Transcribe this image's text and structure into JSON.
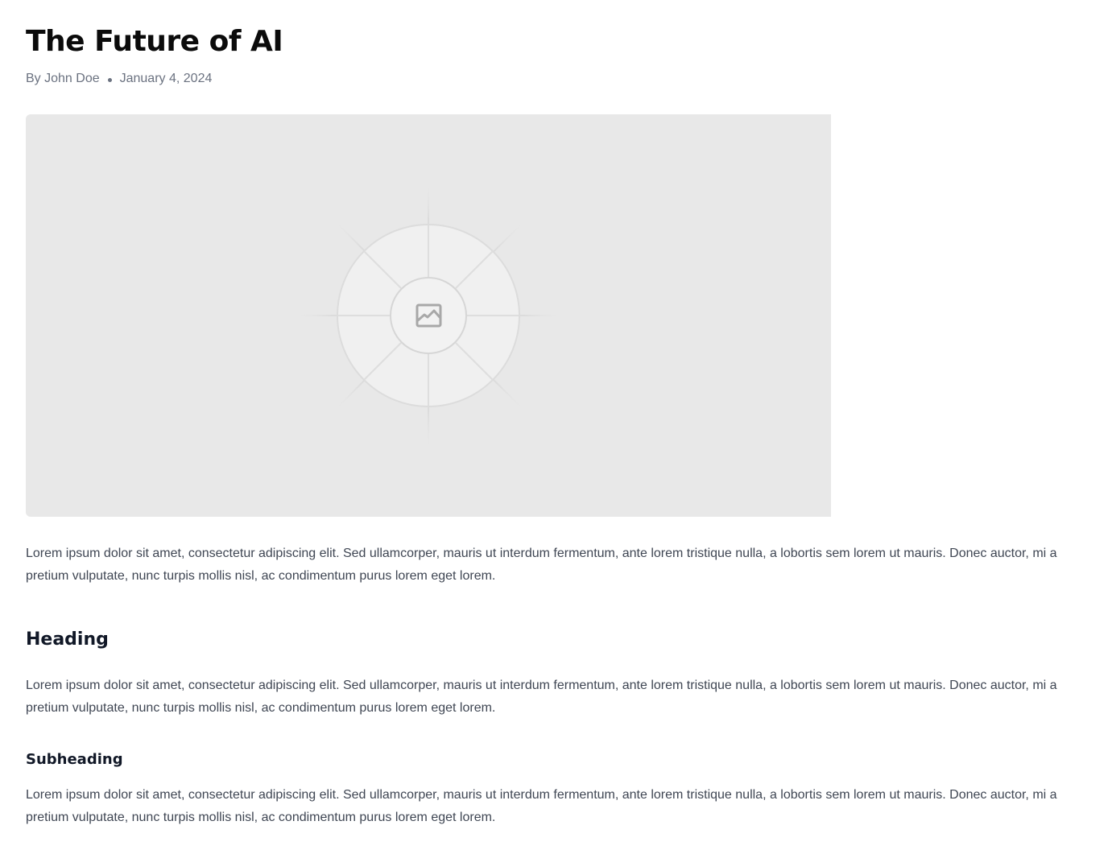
{
  "article": {
    "title": "The Future of AI",
    "author": "By John Doe",
    "date": "January 4, 2024",
    "hero_image_icon": "image-placeholder-icon",
    "paragraph_1": "Lorem ipsum dolor sit amet, consectetur adipiscing elit. Sed ullamcorper, mauris ut interdum fermentum, ante lorem tristique nulla, a lobortis sem lorem ut mauris. Donec auctor, mi a pretium vulputate, nunc turpis mollis nisl, ac condimentum purus lorem eget lorem.",
    "heading": "Heading",
    "paragraph_2": "Lorem ipsum dolor sit amet, consectetur adipiscing elit. Sed ullamcorper, mauris ut interdum fermentum, ante lorem tristique nulla, a lobortis sem lorem ut mauris. Donec auctor, mi a pretium vulputate, nunc turpis mollis nisl, ac condimentum purus lorem eget lorem.",
    "subheading": "Subheading",
    "paragraph_3": "Lorem ipsum dolor sit amet, consectetur adipiscing elit. Sed ullamcorper, mauris ut interdum fermentum, ante lorem tristique nulla, a lobortis sem lorem ut mauris. Donec auctor, mi a pretium vulputate, nunc turpis mollis nisl, ac condimentum purus lorem eget lorem."
  },
  "colors": {
    "title": "#0b0b0b",
    "meta_text": "#6b7280",
    "body_text": "#3f4653",
    "hero_background": "#e8e8e8"
  }
}
